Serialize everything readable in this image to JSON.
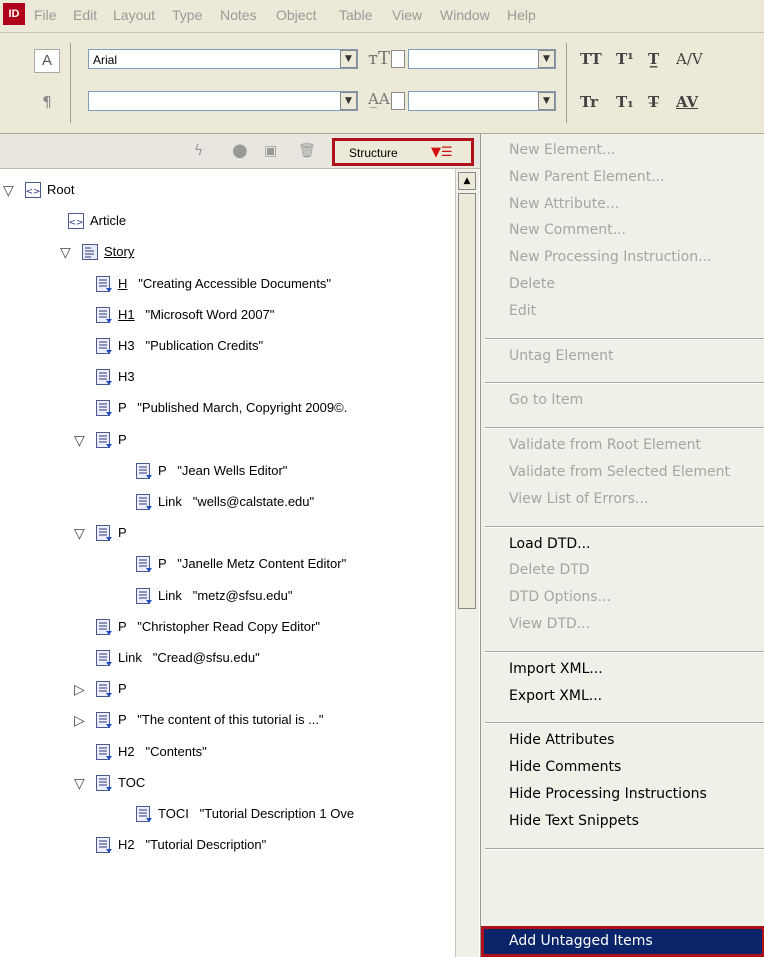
{
  "app": {
    "icon_label": "ID"
  },
  "menubar": [
    "File",
    "Edit",
    "Layout",
    "Type",
    "Notes",
    "Object",
    "Table",
    "View",
    "Window",
    "Help"
  ],
  "controls": {
    "char_icon": "A",
    "para_icon": "¶",
    "font_family": "Arial",
    "font_style": "",
    "glyphs_row1": [
      "TT",
      "T¹",
      "T̲",
      "A/V"
    ],
    "glyphs_row2": [
      "Tr",
      "T₁",
      "T̶",
      "AV"
    ]
  },
  "structure_panel": {
    "tab_label": "Structure",
    "tree": [
      {
        "tag": "Root",
        "text": "",
        "twisty": "open",
        "icon": "element"
      },
      {
        "tag": "Article",
        "text": "",
        "twisty": "",
        "icon": "element"
      },
      {
        "tag": "Story",
        "text": "",
        "twisty": "open",
        "icon": "story"
      },
      {
        "tag": "H",
        "text": "\"Creating Accessible Documents\"",
        "twisty": "",
        "icon": "text"
      },
      {
        "tag": "H1",
        "text": "\"Microsoft Word 2007\"",
        "twisty": "",
        "icon": "text"
      },
      {
        "tag": "H3",
        "text": "\"Publication Credits\"",
        "twisty": "",
        "icon": "text"
      },
      {
        "tag": "H3",
        "text": "",
        "twisty": "",
        "icon": "text"
      },
      {
        "tag": "P",
        "text": "\"Published March, Copyright 2009©.",
        "twisty": "",
        "icon": "text"
      },
      {
        "tag": "P",
        "text": "",
        "twisty": "open",
        "icon": "text"
      },
      {
        "tag": "P",
        "text": "\"Jean Wells Editor\"",
        "twisty": "",
        "icon": "text"
      },
      {
        "tag": "Link",
        "text": "\"wells@calstate.edu\"",
        "twisty": "",
        "icon": "text"
      },
      {
        "tag": "P",
        "text": "",
        "twisty": "open",
        "icon": "text"
      },
      {
        "tag": "P",
        "text": "\"Janelle Metz Content Editor\"",
        "twisty": "",
        "icon": "text"
      },
      {
        "tag": "Link",
        "text": "\"metz@sfsu.edu\"",
        "twisty": "",
        "icon": "text"
      },
      {
        "tag": "P",
        "text": "\"Christopher Read Copy Editor\"",
        "twisty": "",
        "icon": "text"
      },
      {
        "tag": "Link",
        "text": "\"Cread@sfsu.edu\"",
        "twisty": "",
        "icon": "text"
      },
      {
        "tag": "P",
        "text": "",
        "twisty": "closed",
        "icon": "text"
      },
      {
        "tag": "P",
        "text": "\"The content of this tutorial is ...\"",
        "twisty": "closed",
        "icon": "text"
      },
      {
        "tag": "H2",
        "text": "\"Contents\"",
        "twisty": "",
        "icon": "text"
      },
      {
        "tag": "TOC",
        "text": "",
        "twisty": "open",
        "icon": "text"
      },
      {
        "tag": "TOCI",
        "text": "\"Tutorial Description 1 Ove",
        "twisty": "",
        "icon": "text"
      },
      {
        "tag": "H2",
        "text": "\"Tutorial Description\"",
        "twisty": "",
        "icon": "text"
      }
    ]
  },
  "context_menu": {
    "items": [
      {
        "label": "New Element...",
        "enabled": false
      },
      {
        "label": "New Parent Element...",
        "enabled": false
      },
      {
        "label": "New Attribute...",
        "enabled": false
      },
      {
        "label": "New Comment...",
        "enabled": false
      },
      {
        "label": "New Processing Instruction...",
        "enabled": false
      },
      {
        "label": "Delete",
        "enabled": false
      },
      {
        "label": "Edit",
        "enabled": false
      },
      {
        "sep": true
      },
      {
        "label": "Untag Element",
        "enabled": false
      },
      {
        "sep": true
      },
      {
        "label": "Go to Item",
        "enabled": false
      },
      {
        "sep": true
      },
      {
        "label": "Validate from Root Element",
        "enabled": false
      },
      {
        "label": "Validate from Selected Element",
        "enabled": false
      },
      {
        "label": "View List of Errors...",
        "enabled": false
      },
      {
        "sep": true
      },
      {
        "label": "Load DTD...",
        "enabled": true
      },
      {
        "label": "Delete DTD",
        "enabled": false
      },
      {
        "label": "DTD Options...",
        "enabled": false
      },
      {
        "label": "View DTD...",
        "enabled": false
      },
      {
        "sep": true
      },
      {
        "label": "Import XML...",
        "enabled": true
      },
      {
        "label": "Export XML...",
        "enabled": true
      },
      {
        "sep": true
      },
      {
        "label": "Hide Attributes",
        "enabled": true
      },
      {
        "label": "Hide Comments",
        "enabled": true
      },
      {
        "label": "Hide Processing Instructions",
        "enabled": true
      },
      {
        "label": "Hide Text Snippets",
        "enabled": true
      },
      {
        "sep": true
      }
    ],
    "highlighted_item": "Add Untagged Items"
  }
}
